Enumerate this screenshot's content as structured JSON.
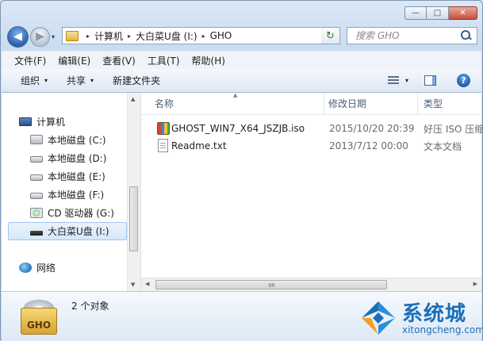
{
  "window": {
    "min_glyph": "—",
    "max_glyph": "□",
    "close_glyph": "✕"
  },
  "nav": {
    "back_glyph": "◀",
    "forward_glyph": "▶",
    "history_glyph": "▾"
  },
  "address": {
    "crumbs": [
      "计算机",
      "大白菜U盘 (I:)",
      "GHO"
    ],
    "separator": "▸",
    "dropdown_glyph": "▾",
    "refresh_glyph": "↻"
  },
  "search": {
    "placeholder": "搜索 GHO"
  },
  "menu": [
    "文件(F)",
    "编辑(E)",
    "查看(V)",
    "工具(T)",
    "帮助(H)"
  ],
  "toolbar": {
    "organize": "组织",
    "share": "共享",
    "new_folder": "新建文件夹",
    "dropdown_glyph": "▾",
    "help_glyph": "?"
  },
  "sidebar": {
    "computer": "计算机",
    "drives": [
      {
        "label": "本地磁盘 (C:)",
        "icon": "system-drive-icon"
      },
      {
        "label": "本地磁盘 (D:)",
        "icon": "drive-icon"
      },
      {
        "label": "本地磁盘 (E:)",
        "icon": "drive-icon"
      },
      {
        "label": "本地磁盘 (F:)",
        "icon": "drive-icon"
      },
      {
        "label": "CD 驱动器 (G:)",
        "icon": "cd-drive-icon"
      },
      {
        "label": "大白菜U盘 (I:)",
        "icon": "usb-drive-icon",
        "selected": true
      }
    ],
    "network": "网络"
  },
  "columns": {
    "name": "名称",
    "modified": "修改日期",
    "type": "类型",
    "sort_glyph": "▲"
  },
  "files": [
    {
      "name": "GHOST_WIN7_X64_JSZJB.iso",
      "modified": "2015/10/20 20:39",
      "type": "好压 ISO 压缩",
      "icon": "iso-archive-icon"
    },
    {
      "name": "Readme.txt",
      "modified": "2013/7/12 00:00",
      "type": "文本文档",
      "icon": "text-file-icon"
    }
  ],
  "details": {
    "folder_badge": "GHO",
    "count": "2 个对象"
  },
  "watermark": {
    "brand": "系统城",
    "url": "xitongcheng.com"
  },
  "colors": {
    "accent": "#1b6fb8",
    "selection": "#d6e8fb"
  }
}
